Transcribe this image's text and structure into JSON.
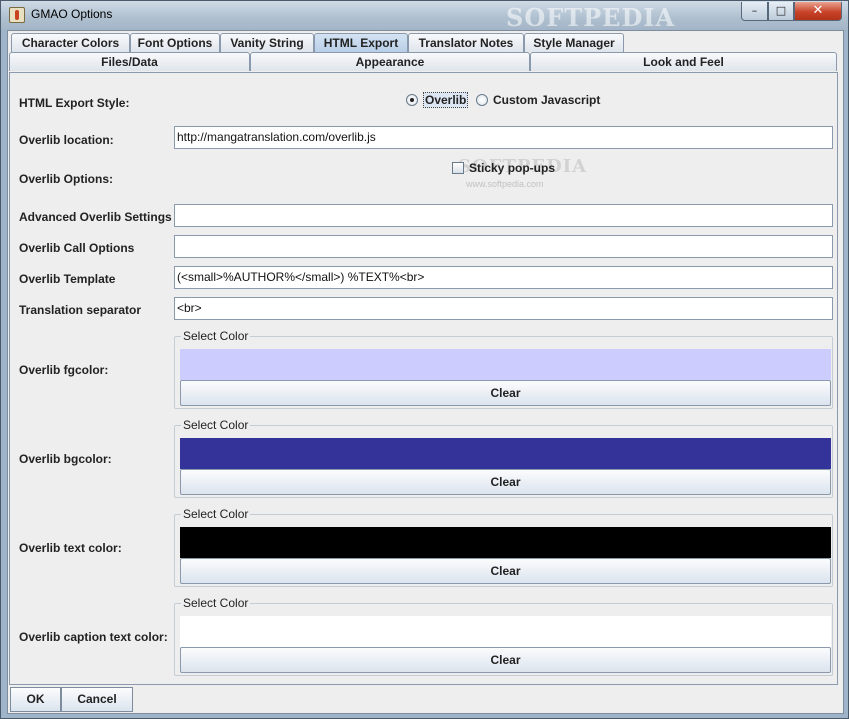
{
  "window": {
    "title": "GMAO Options",
    "watermark": "SOFTPEDIA",
    "controls": {
      "minimize": "–",
      "maximize": "□",
      "close": "✕"
    }
  },
  "tabs_top": [
    {
      "label": "Character Colors",
      "selected": false
    },
    {
      "label": "Font Options",
      "selected": false
    },
    {
      "label": "Vanity String",
      "selected": false
    },
    {
      "label": "HTML Export",
      "selected": true
    },
    {
      "label": "Translator Notes",
      "selected": false
    },
    {
      "label": "Style Manager",
      "selected": false
    }
  ],
  "tabs_bottom": [
    {
      "label": "Files/Data"
    },
    {
      "label": "Appearance"
    },
    {
      "label": "Look and Feel"
    }
  ],
  "form": {
    "export_style": {
      "label": "HTML Export Style:",
      "options": [
        "Overlib",
        "Custom Javascript"
      ],
      "selected": "Overlib"
    },
    "overlib_location": {
      "label": "Overlib location:",
      "value": "http://mangatranslation.com/overlib.js"
    },
    "overlib_options": {
      "label": "Overlib Options:",
      "checkbox_label": "Sticky pop-ups",
      "checked": false
    },
    "advanced_settings": {
      "label": "Advanced Overlib Settings",
      "value": ""
    },
    "call_options": {
      "label": "Overlib Call Options",
      "value": ""
    },
    "template": {
      "label": "Overlib Template",
      "value": "(<small>%AUTHOR%</small>) %TEXT%<br>"
    },
    "separator": {
      "label": "Translation separator",
      "value": "<br>"
    }
  },
  "watermarks": {
    "mid": "SOFTPEDIA",
    "url": "www.softpedia.com"
  },
  "color_pickers": [
    {
      "label": "Overlib fgcolor:",
      "group_title": "Select Color",
      "color": "#ccccff",
      "clear_label": "Clear"
    },
    {
      "label": "Overlib bgcolor:",
      "group_title": "Select Color",
      "color": "#333399",
      "clear_label": "Clear"
    },
    {
      "label": "Overlib text color:",
      "group_title": "Select Color",
      "color": "#000000",
      "clear_label": "Clear"
    },
    {
      "label": "Overlib caption text color:",
      "group_title": "Select Color",
      "color": "#ffffff",
      "clear_label": "Clear"
    }
  ],
  "buttons": {
    "ok": "OK",
    "cancel": "Cancel"
  }
}
